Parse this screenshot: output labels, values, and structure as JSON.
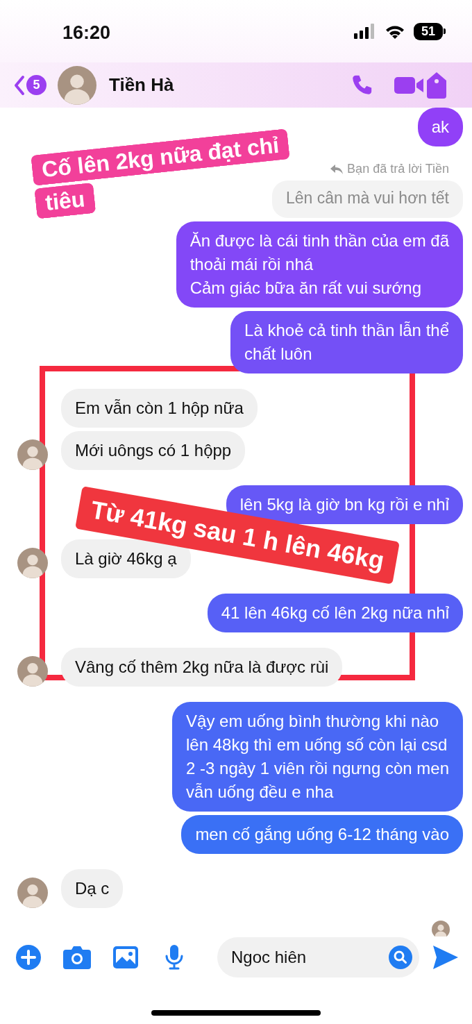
{
  "status_bar": {
    "time": "16:20",
    "battery": "51"
  },
  "header": {
    "back_count": "5",
    "name": "Tiền Hà"
  },
  "messages": [
    {
      "kind": "sent",
      "text": "ak"
    },
    {
      "kind": "reply_note",
      "text": "Bạn đã trả lời Tiền"
    },
    {
      "kind": "quoted",
      "text": "Lên cân mà vui hơn tết"
    },
    {
      "kind": "sent",
      "text": "Ăn được là cái tinh thần của em đã\nthoải mái rồi nhá\nCảm giác bữa ăn rất vui sướng"
    },
    {
      "kind": "sent",
      "text": "Là khoẻ cả tinh thần lẫn thể\nchất luôn"
    },
    {
      "kind": "received",
      "text": "Em vẫn còn 1 hộp nữa"
    },
    {
      "kind": "received",
      "text": "Mới uôngs có 1 hộpp"
    },
    {
      "kind": "sent",
      "text": "lên 5kg là giờ bn kg rồi e nhỉ"
    },
    {
      "kind": "received",
      "text": "Là giờ 46kg ạ"
    },
    {
      "kind": "sent",
      "text": "41 lên 46kg cố lên 2kg nữa nhỉ"
    },
    {
      "kind": "received",
      "text": "Vâng cố thêm 2kg nữa là được rùi"
    },
    {
      "kind": "sent",
      "text": "Vậy em uống bình thường khi nào\nlên 48kg thì em uống số còn lại csd\n2 -3 ngày 1 viên rồi ngưng còn men\nvẫn uống đều e nha"
    },
    {
      "kind": "sent",
      "text": "men cố gắng uống 6-12 tháng vào"
    },
    {
      "kind": "received",
      "text": "Dạ c"
    }
  ],
  "composer": {
    "value": "Ngoc hiên"
  },
  "annotations": [
    {
      "kind": "sticker",
      "text": "Cố lên 2kg nữa đạt chỉ\ntiêu"
    },
    {
      "kind": "frame"
    },
    {
      "kind": "banner",
      "text": "Từ 41kg sau 1 h lên 46kg"
    }
  ]
}
